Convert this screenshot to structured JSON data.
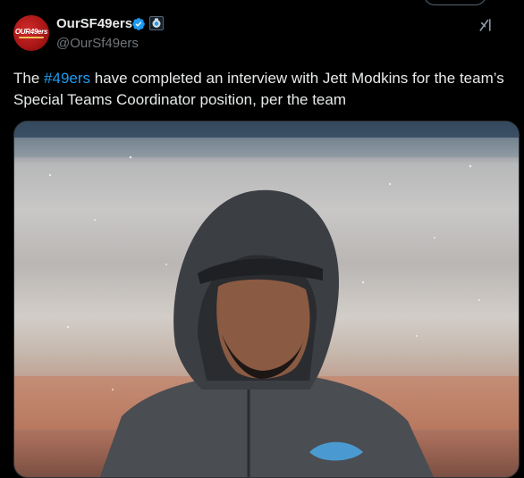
{
  "header": {
    "display_name": "OurSF49ers",
    "handle": "@OurSf49ers",
    "avatar_text": "OUR49ers"
  },
  "tweet": {
    "text_prefix": "The ",
    "hashtag": "#49ers",
    "text_suffix": " have completed an interview with Jett Modkins for the team’s Special Teams Coordinator position, per the team"
  },
  "icons": {
    "verified": "verified-badge-icon",
    "affiliation": "affiliate-badge-icon",
    "grok": "grok-icon"
  },
  "colors": {
    "background": "#000000",
    "text": "#e7e9ea",
    "muted": "#71767b",
    "link": "#1d9bf0",
    "verified": "#1d9bf0"
  }
}
